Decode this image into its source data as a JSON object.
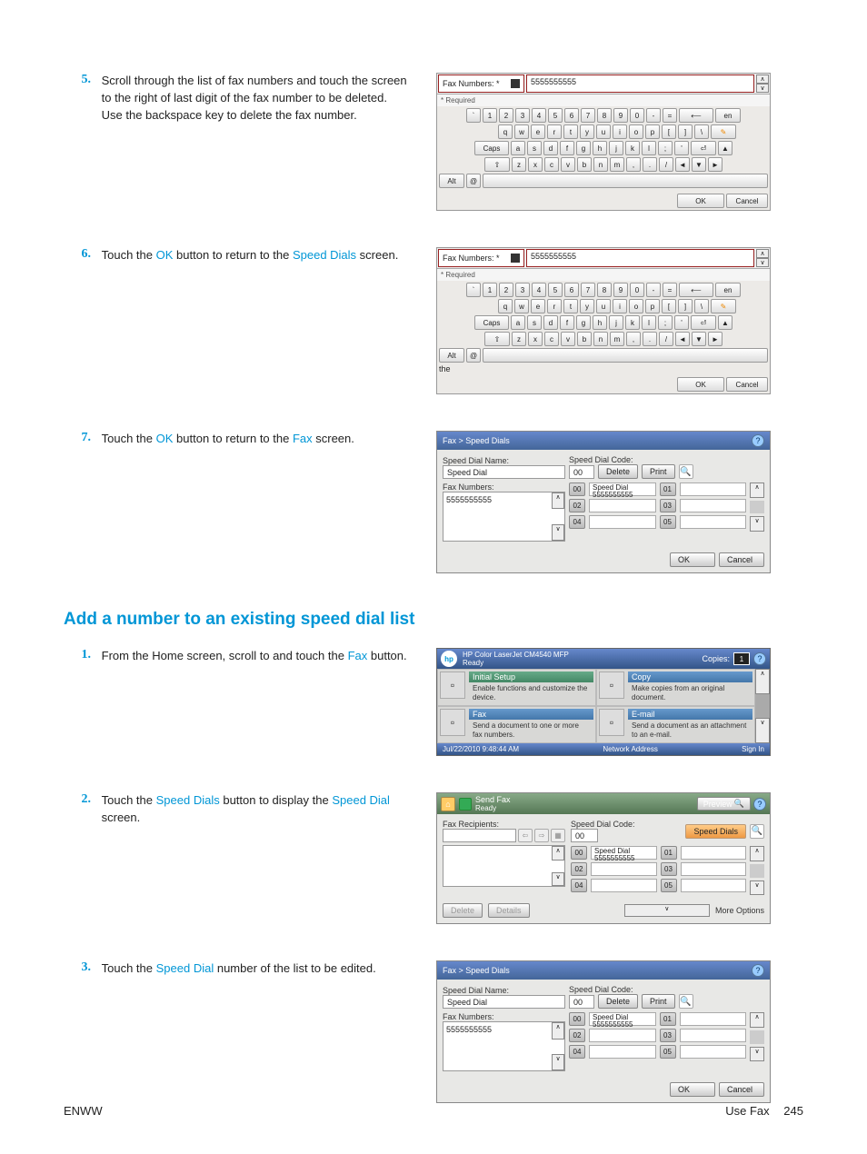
{
  "steps_top": [
    {
      "num": "5.",
      "text_parts": [
        "Scroll through the list of fax numbers and touch the screen to the right of last digit of the fax number to be deleted. Use the backspace key to delete the fax number."
      ]
    },
    {
      "num": "6.",
      "text_parts_linked": [
        {
          "t": "Touch the "
        },
        {
          "t": "OK",
          "l": true
        },
        {
          "t": " button to return to the "
        },
        {
          "t": "Speed Dials",
          "l": true
        },
        {
          "t": " screen."
        }
      ]
    },
    {
      "num": "7.",
      "text_parts_linked": [
        {
          "t": "Touch the "
        },
        {
          "t": "OK",
          "l": true
        },
        {
          "t": " button to return to the "
        },
        {
          "t": "Fax",
          "l": true
        },
        {
          "t": " screen."
        }
      ]
    }
  ],
  "section_heading": "Add a number to an existing speed dial list",
  "steps_bottom": [
    {
      "num": "1.",
      "text_parts_linked": [
        {
          "t": "From the Home screen, scroll to and touch the "
        },
        {
          "t": "Fax",
          "l": true
        },
        {
          "t": " button."
        }
      ]
    },
    {
      "num": "2.",
      "text_parts_linked": [
        {
          "t": "Touch the "
        },
        {
          "t": "Speed Dials",
          "l": true
        },
        {
          "t": " button to display the "
        },
        {
          "t": "Speed Dial",
          "l": true
        },
        {
          "t": " screen."
        }
      ]
    },
    {
      "num": "3.",
      "text_parts_linked": [
        {
          "t": "Touch the "
        },
        {
          "t": "Speed Dial",
          "l": true
        },
        {
          "t": " number of the list to be edited."
        }
      ]
    }
  ],
  "kbd": {
    "label": "Fax Numbers: *",
    "value": "5555555555",
    "required": "* Required",
    "row1": [
      "`",
      "1",
      "2",
      "3",
      "4",
      "5",
      "6",
      "7",
      "8",
      "9",
      "0",
      "-",
      "="
    ],
    "row2": [
      "q",
      "w",
      "e",
      "r",
      "t",
      "y",
      "u",
      "i",
      "o",
      "p",
      "[",
      "]",
      "\\"
    ],
    "row3_lead": "Caps",
    "row3": [
      "a",
      "s",
      "d",
      "f",
      "g",
      "h",
      "j",
      "k",
      "l",
      ";",
      "'"
    ],
    "row4_lead": "⇧",
    "row4": [
      "z",
      "x",
      "c",
      "v",
      "b",
      "n",
      "m",
      ",",
      ".",
      "/"
    ],
    "row5_lead": "Alt",
    "at": "@",
    "backspace": "⟵",
    "en": "en",
    "ok": "OK",
    "cancel": "Cancel"
  },
  "sd": {
    "title": "Fax > Speed Dials",
    "name_label": "Speed Dial Name:",
    "name_value": "Speed Dial",
    "code_label": "Speed Dial Code:",
    "code_value": "00",
    "delete": "Delete",
    "print": "Print",
    "faxnums_label": "Fax Numbers:",
    "faxnums_value": "5555555555",
    "slots": [
      {
        "n": "00",
        "t": "Speed Dial\n5555555555"
      },
      {
        "n": "01",
        "t": ""
      },
      {
        "n": "02",
        "t": ""
      },
      {
        "n": "03",
        "t": ""
      },
      {
        "n": "04",
        "t": ""
      },
      {
        "n": "05",
        "t": ""
      }
    ],
    "ok": "OK",
    "cancel": "Cancel"
  },
  "home": {
    "model": "HP Color LaserJet CM4540 MFP",
    "ready": "Ready",
    "copies_label": "Copies:",
    "copies_value": "1",
    "tiles": [
      {
        "title": "Initial Setup",
        "desc": "Enable functions and customize the device.",
        "blue": false
      },
      {
        "title": "Copy",
        "desc": "Make copies from an original document.",
        "blue": true
      },
      {
        "title": "Fax",
        "desc": "Send a document to one or more fax numbers.",
        "blue": true
      },
      {
        "title": "E-mail",
        "desc": "Send a document as an attachment to an e-mail.",
        "blue": true
      }
    ],
    "timestamp": "Jul/22/2010 9:48:44 AM",
    "network": "Network Address",
    "signin": "Sign In"
  },
  "sf": {
    "title": "Send Fax",
    "ready": "Ready",
    "preview": "Preview",
    "recip_label": "Fax Recipients:",
    "code_label": "Speed Dial Code:",
    "code_value": "00",
    "speeddials": "Speed Dials",
    "slots": [
      {
        "n": "00",
        "t": "Speed Dial\n5555555555"
      },
      {
        "n": "01",
        "t": ""
      },
      {
        "n": "02",
        "t": ""
      },
      {
        "n": "03",
        "t": ""
      },
      {
        "n": "04",
        "t": ""
      },
      {
        "n": "05",
        "t": ""
      }
    ],
    "delete": "Delete",
    "details": "Details",
    "more": "More Options"
  },
  "footer": {
    "left": "ENWW",
    "right_label": "Use Fax",
    "page": "245"
  }
}
